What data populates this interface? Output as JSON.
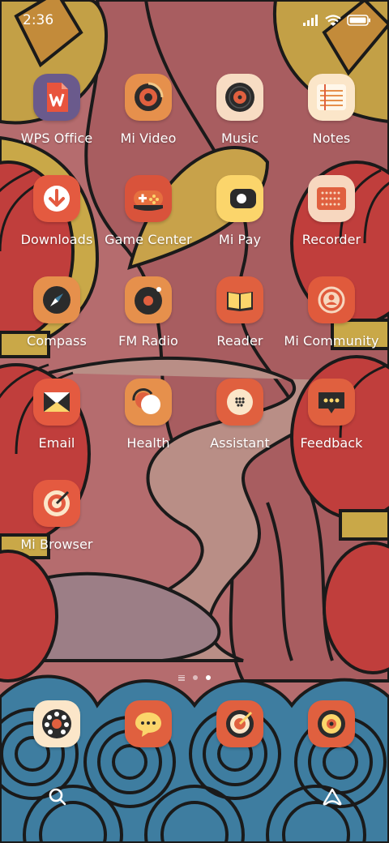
{
  "status_bar": {
    "time": "2:36"
  },
  "apps": [
    {
      "label": "WPS Office",
      "icon": "wps-office-icon",
      "bg": "#6a5a8c"
    },
    {
      "label": "Mi Video",
      "icon": "mi-video-icon",
      "bg": "#e6904c"
    },
    {
      "label": "Music",
      "icon": "music-icon",
      "bg": "#f7dcc3"
    },
    {
      "label": "Notes",
      "icon": "notes-icon",
      "bg": "#fbe6c9"
    },
    {
      "label": "Downloads",
      "icon": "downloads-icon",
      "bg": "#e45a40"
    },
    {
      "label": "Game Center",
      "icon": "game-center-icon",
      "bg": "#d9533b"
    },
    {
      "label": "Mi Pay",
      "icon": "mi-pay-icon",
      "bg": "#fbd56b"
    },
    {
      "label": "Recorder",
      "icon": "recorder-icon",
      "bg": "#f7d7bf"
    },
    {
      "label": "Compass",
      "icon": "compass-icon",
      "bg": "#e6904c"
    },
    {
      "label": "FM Radio",
      "icon": "fm-radio-icon",
      "bg": "#e6904c"
    },
    {
      "label": "Reader",
      "icon": "reader-icon",
      "bg": "#e0603f"
    },
    {
      "label": "Mi Community",
      "icon": "mi-community-icon",
      "bg": "#e05a3c"
    },
    {
      "label": "Email",
      "icon": "email-icon",
      "bg": "#e45a40"
    },
    {
      "label": "Health",
      "icon": "health-icon",
      "bg": "#e6904c"
    },
    {
      "label": "Assistant",
      "icon": "assistant-icon",
      "bg": "#e0603f"
    },
    {
      "label": "Feedback",
      "icon": "feedback-icon",
      "bg": "#e0603f"
    },
    {
      "label": "Mi Browser",
      "icon": "mi-browser-icon",
      "bg": "#e45a40"
    }
  ],
  "dock": [
    {
      "icon": "phone-dialer-icon",
      "bg": "#fbe6c9"
    },
    {
      "icon": "messages-icon",
      "bg": "#e0603f"
    },
    {
      "icon": "browser-icon",
      "bg": "#e0603f"
    },
    {
      "icon": "camera-icon",
      "bg": "#e0603f"
    }
  ],
  "pages": {
    "count": 2,
    "current": 2
  },
  "bottom_bar": {
    "left_icon": "search-icon",
    "right_icon": "assistant-launcher-icon"
  }
}
